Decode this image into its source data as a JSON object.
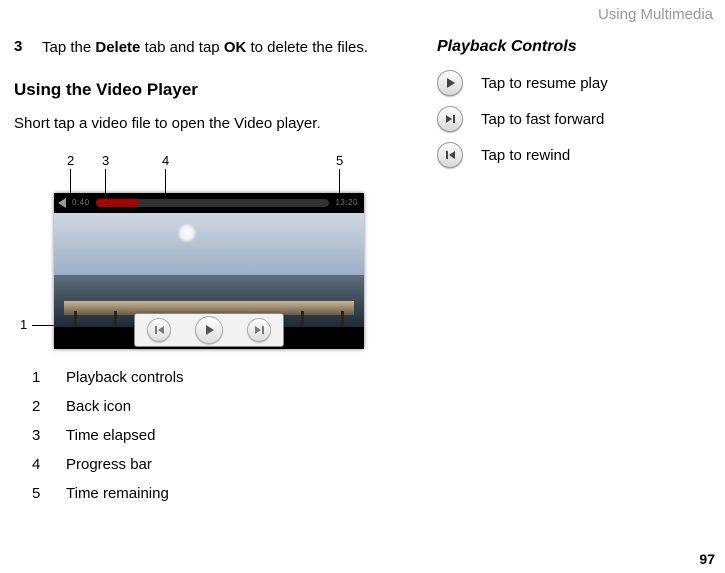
{
  "header": {
    "section_title": "Using Multimedia"
  },
  "left": {
    "step_num": "3",
    "step_text_pre": "Tap the ",
    "step_bold1": "Delete",
    "step_text_mid": " tab and tap ",
    "step_bold2": "OK",
    "step_text_post": " to delete the files.",
    "heading": "Using the Video Player",
    "intro": "Short tap a video file to open the Video player.",
    "callouts": {
      "c1": "1",
      "c2": "2",
      "c3": "3",
      "c4": "4",
      "c5": "5"
    },
    "player": {
      "time_elapsed": "0:40",
      "time_remain": "13:20"
    },
    "legend": [
      {
        "n": "1",
        "label": "Playback controls"
      },
      {
        "n": "2",
        "label": "Back icon"
      },
      {
        "n": "3",
        "label": "Time elapsed"
      },
      {
        "n": "4",
        "label": "Progress bar"
      },
      {
        "n": "5",
        "label": "Time remaining"
      }
    ]
  },
  "right": {
    "heading": "Playback Controls",
    "items": [
      {
        "label": "Tap to resume play"
      },
      {
        "label": "Tap to fast forward"
      },
      {
        "label": "Tap to rewind"
      }
    ]
  },
  "page_number": "97"
}
